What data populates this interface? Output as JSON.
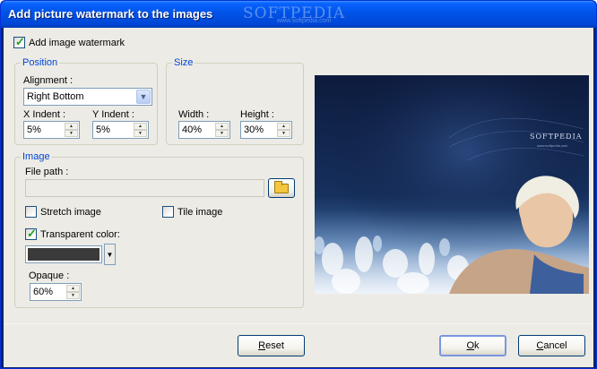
{
  "window": {
    "title": "Add picture watermark to the images",
    "title_watermark": "SOFTPEDIA",
    "title_watermark_sub": "www.softpedia.com"
  },
  "add_watermark": {
    "label": "Add image watermark",
    "checked": true
  },
  "position": {
    "group_title": "Position",
    "alignment_label": "Alignment :",
    "alignment_value": "Right Bottom",
    "x_indent_label": "X Indent :",
    "x_indent_value": "5%",
    "y_indent_label": "Y Indent :",
    "y_indent_value": "5%"
  },
  "size": {
    "group_title": "Size",
    "width_label": "Width :",
    "width_value": "40%",
    "height_label": "Height :",
    "height_value": "30%"
  },
  "image": {
    "group_title": "Image",
    "file_path_label": "File path :",
    "file_path_value": "",
    "stretch": {
      "label": "Stretch image",
      "checked": false
    },
    "tile": {
      "label": "Tile image",
      "checked": false
    },
    "transparent": {
      "label": "Transparent color:",
      "checked": true
    },
    "transparent_color": "#3a3a3a",
    "opaque_label": "Opaque :",
    "opaque_value": "60%"
  },
  "preview": {
    "watermark_text": "SOFTPEDIA",
    "watermark_sub": "www.softpedia.com"
  },
  "buttons": {
    "reset": {
      "label": "Reset",
      "mnemonic": "R"
    },
    "ok": {
      "label": "Ok",
      "mnemonic": "O"
    },
    "cancel": {
      "label": "Cancel",
      "mnemonic": "C"
    }
  },
  "icons": [
    "check-icon",
    "dropdown-arrow-icon",
    "spin-up-icon",
    "spin-down-icon",
    "folder-icon"
  ]
}
